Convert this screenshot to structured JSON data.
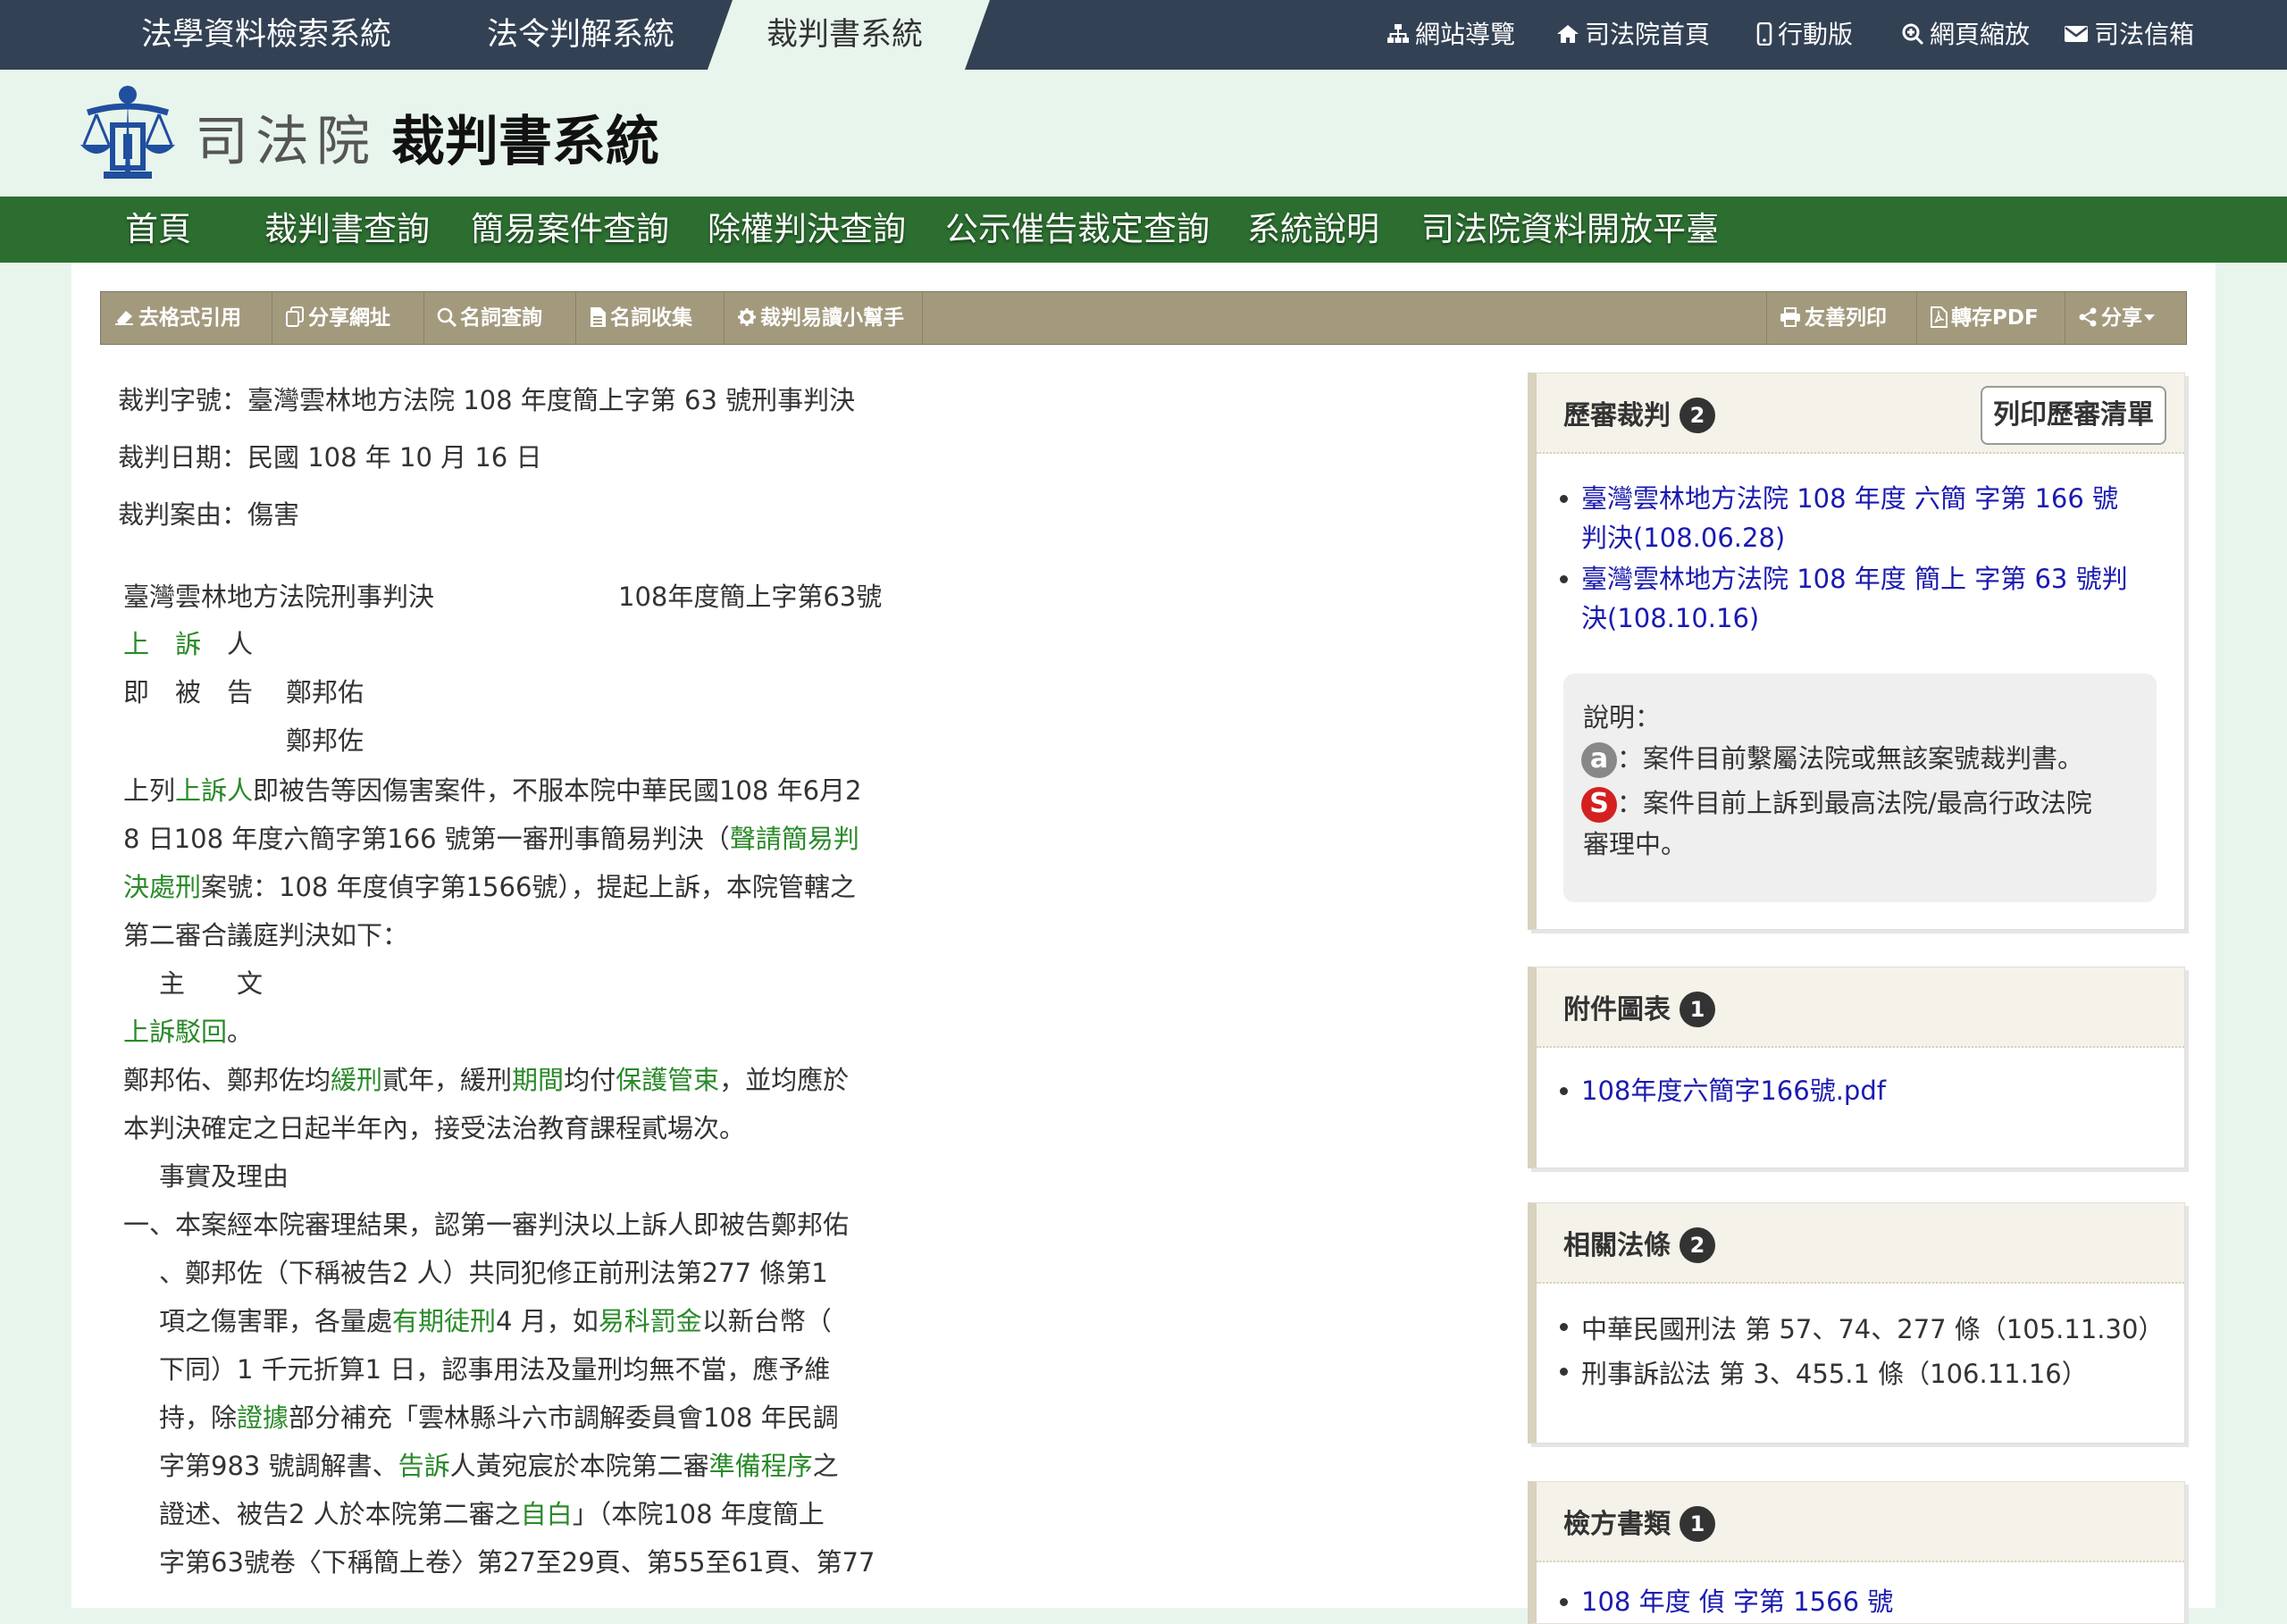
{
  "top_tabs": [
    "法學資料檢索系統",
    "法令判解系統",
    "裁判書系統"
  ],
  "utility_links": [
    {
      "label": "網站導覽",
      "icon": "sitemap-icon"
    },
    {
      "label": "司法院首頁",
      "icon": "home-icon"
    },
    {
      "label": "行動版",
      "icon": "mobile-icon"
    },
    {
      "label": "網頁縮放",
      "icon": "zoom-icon"
    },
    {
      "label": "司法信箱",
      "icon": "mail-icon"
    }
  ],
  "header": {
    "org_name": "司法院",
    "system_title": "裁判書系統"
  },
  "main_nav": [
    "首頁",
    "裁判書查詢",
    "簡易案件查詢",
    "除權判決查詢",
    "公示催告裁定查詢",
    "系統說明",
    "司法院資料開放平臺"
  ],
  "toolbar": {
    "left": [
      "去格式引用",
      "分享網址",
      "名詞查詢",
      "名詞收集",
      "裁判易讀小幫手"
    ],
    "right": [
      "友善列印",
      "轉存PDF",
      "分享"
    ]
  },
  "meta": {
    "case_no": "裁判字號：臺灣雲林地方法院 108 年度簡上字第 63 號刑事判決",
    "date": "裁判日期：民國 108 年 10 月 16 日",
    "cause": "裁判案由：傷害"
  },
  "judgment": {
    "court": "臺灣雲林地方法院刑事判決",
    "number": "108年度簡上字第63號",
    "p_appellant": "上　訴",
    "p_person": "人",
    "p_defendant_label": "即　被　告",
    "defendant1": "鄭邦佑",
    "defendant2": "鄭邦佐",
    "l1a": "上列",
    "l1b": "上訴人",
    "l1c": "即被告等因傷害案件，不服本院中華民國108 年6月2",
    "l2a": "8 日108 年度六簡字第166 號第一審刑事簡易判決（",
    "l2b": "聲請簡易判",
    "l3a": "決處刑",
    "l3b": "案號：108 年度偵字第1566號），提起上訴，本院管轄之",
    "l4": "第二審合議庭判決如下：",
    "main_heading": "主　　文",
    "r1a": "上訴駁回",
    "r1b": "。",
    "r2a": "鄭邦佑、鄭邦佐均",
    "r2b": "緩刑",
    "r2c": "貳年，緩刑",
    "r2d": "期間",
    "r2e": "均付",
    "r2f": "保護管束",
    "r2g": "，並均應於",
    "r3": "本判決確定之日起半年內，接受法治教育課程貳場次。",
    "facts_heading": "事實及理由",
    "f1": "一、本案經本院審理結果，認第一審判決以上訴人即被告鄭邦佑",
    "f2": "、鄭邦佐（下稱被告2 人）共同犯修正前刑法第277 條第1",
    "f3a": "項之傷害罪，各量處",
    "f3b": "有期徒刑",
    "f3c": "4 月，如",
    "f3d": "易科罰金",
    "f3e": "以新台幣（",
    "f4": "下同）1 千元折算1 日，認事用法及量刑均無不當，應予維",
    "f5a": "持，除",
    "f5b": "證據",
    "f5c": "部分補充「雲林縣斗六市調解委員會108 年民調",
    "f6a": "字第983 號調解書、",
    "f6b": "告訴",
    "f6c": "人黃宛宸於本院第二審",
    "f6d": "準備程序",
    "f6e": "之",
    "f7a": "證述、被告2 人於本院第二審之",
    "f7b": "自白",
    "f7c": "」（本院108 年度簡上",
    "f8": "字第63號卷〈下稱簡上卷〉第27至29頁、第55至61頁、第77"
  },
  "sidebar": {
    "history": {
      "title": "歷審裁判",
      "count": "2",
      "print_label": "列印歷審清單",
      "items": [
        {
          "line1": "臺灣雲林地方法院 108 年度 六簡 字第 166 號",
          "line2": "判決(108.06.28)"
        },
        {
          "line1": "臺灣雲林地方法院 108 年度 簡上 字第 63 號判",
          "line2": "決(108.10.16)"
        }
      ],
      "note_label": "說明：",
      "note_a_symbol": "a",
      "note_a": "：案件目前繫屬法院或無該案號裁判書。",
      "note_s_symbol": "S",
      "note_s1": "：案件目前上訴到最高法院/最高行政法院",
      "note_s2": "審理中。"
    },
    "attachments": {
      "title": "附件圖表",
      "count": "1",
      "items": [
        "108年度六簡字166號.pdf"
      ]
    },
    "laws": {
      "title": "相關法條",
      "count": "2",
      "items": [
        "中華民國刑法 第 57、74、277 條（105.11.30）",
        "刑事訴訟法 第 3、455.1 條（106.11.16）"
      ]
    },
    "prosecution": {
      "title": "檢方書類",
      "count": "1",
      "items": [
        "108 年度 偵 字第 1566 號"
      ]
    }
  },
  "colors": {
    "topbar": "#334154",
    "nav": "#2c6e30",
    "header_bg": "#e8f5ec",
    "toolbar": "#a39a7e",
    "keyword": "#2a8a2a",
    "link": "#1a1ab0"
  }
}
